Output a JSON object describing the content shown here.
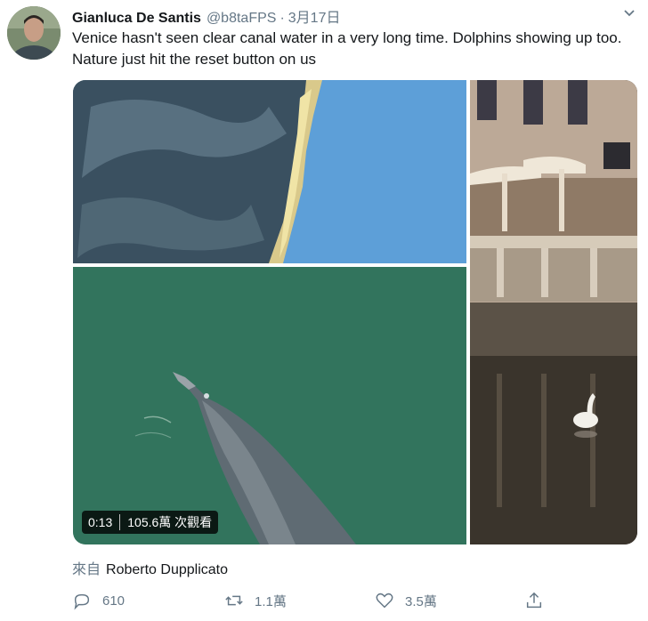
{
  "tweet": {
    "author_name": "Gianluca De Santis",
    "handle": "@b8taFPS",
    "separator": "·",
    "date": "3月17日",
    "text": "Venice hasn't seen clear canal water in a very long time. Dolphins showing up too. Nature just hit the reset button on us"
  },
  "video": {
    "duration": "0:13",
    "views": "105.6萬 次觀看"
  },
  "source": {
    "prefix": "來自",
    "name": "Roberto Dupplicato"
  },
  "actions": {
    "replies": "610",
    "retweets": "1.1萬",
    "likes": "3.5萬"
  },
  "icons": {
    "reply": "reply-icon",
    "retweet": "retweet-icon",
    "like": "heart-icon",
    "share": "share-icon",
    "menu": "chevron-down-icon"
  },
  "colors": {
    "text": "#14171a",
    "muted": "#657786"
  }
}
